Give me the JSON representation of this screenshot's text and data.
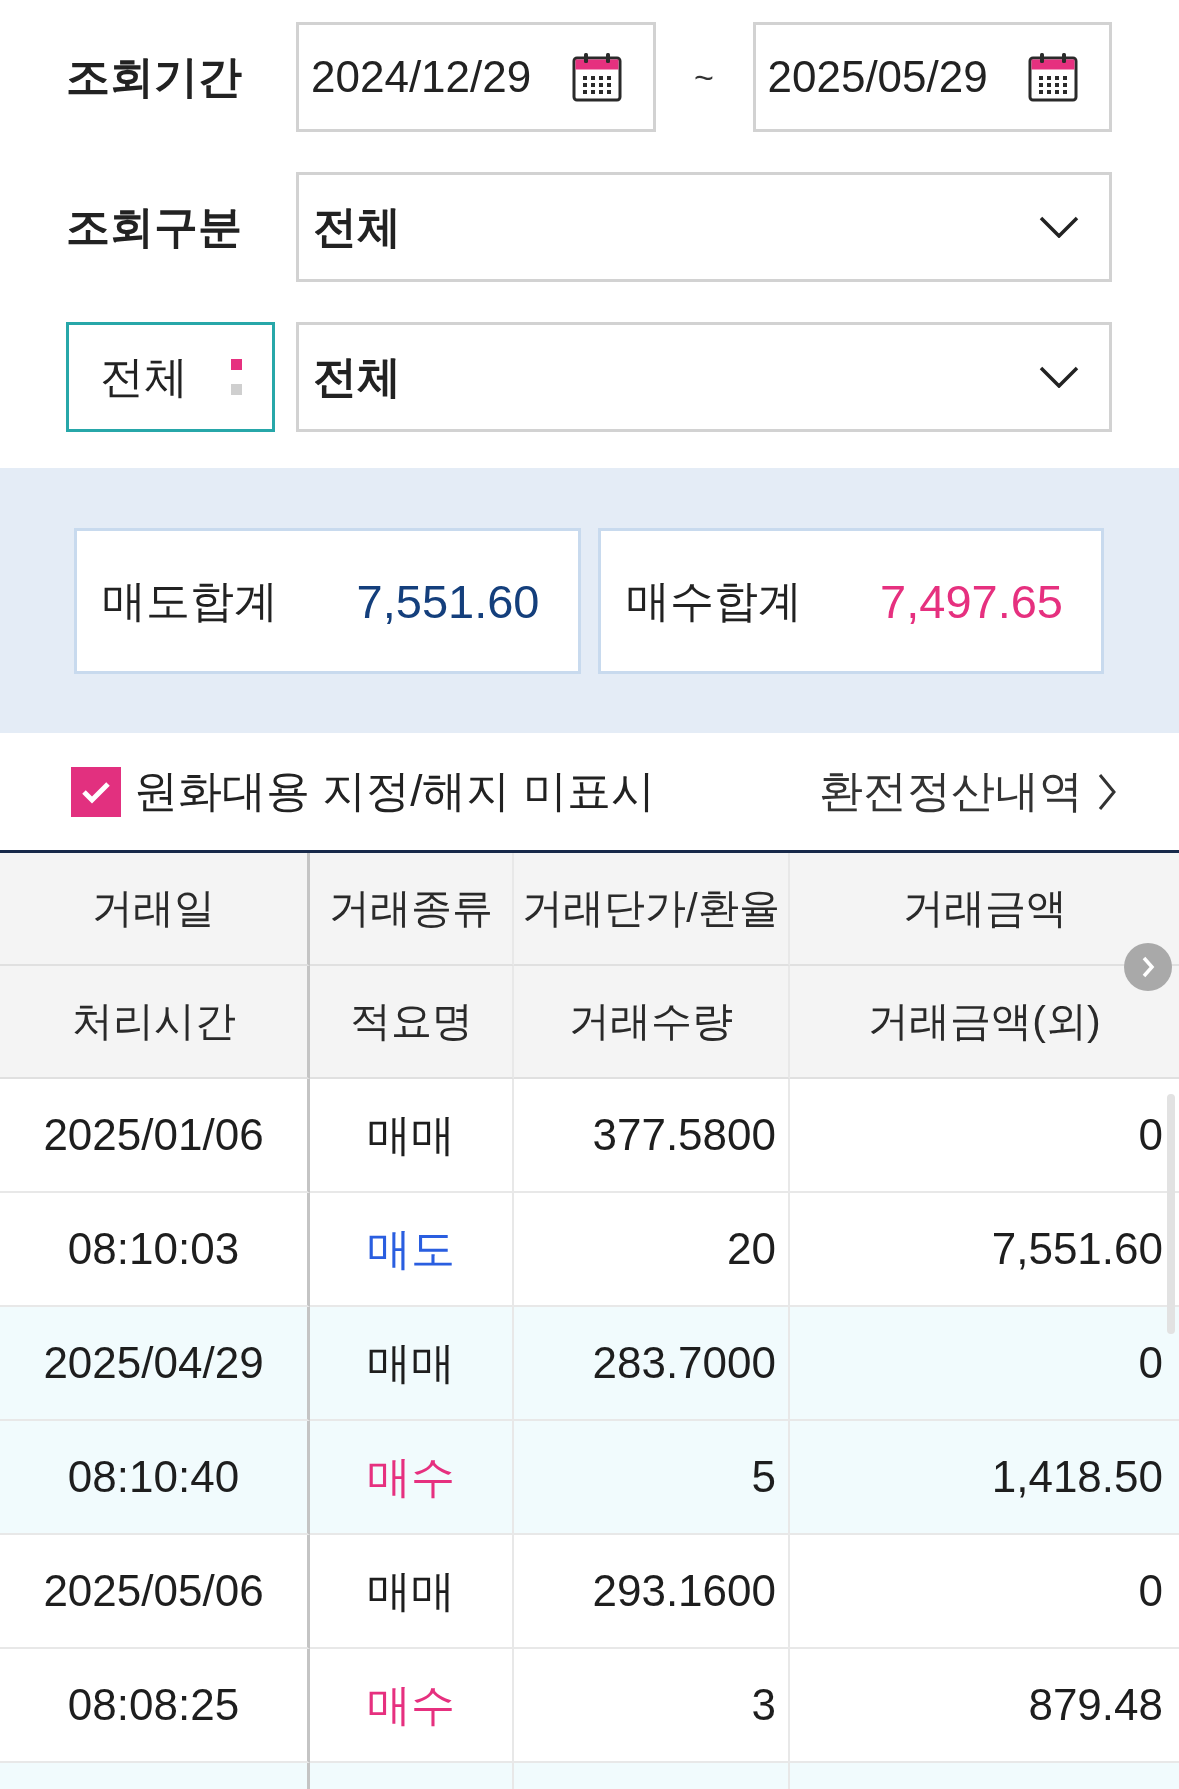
{
  "filters": {
    "period": {
      "label": "조회기간",
      "start": "2024/12/29",
      "separator": "~",
      "end": "2025/05/29"
    },
    "category": {
      "label": "조회구분",
      "value": "전체"
    },
    "scope": {
      "selector": "전체",
      "value": "전체"
    }
  },
  "summary": [
    {
      "label": "매도합계",
      "value": "7,551.60",
      "kind": "sell"
    },
    {
      "label": "매수합계",
      "value": "7,497.65",
      "kind": "buy"
    }
  ],
  "options": {
    "checkbox": {
      "label": "원화대용 지정/해지 미표시",
      "checked": true
    },
    "link": "환전정산내역"
  },
  "table": {
    "columns": [
      {
        "top": "거래일",
        "bottom": "처리시간"
      },
      {
        "top": "거래종류",
        "bottom": "적요명"
      },
      {
        "top": "거래단가/환율",
        "bottom": "거래수량"
      },
      {
        "top": "거래금액",
        "bottom": "거래금액(외)"
      }
    ],
    "rows": [
      {
        "date": "2025/01/06",
        "type": "매매",
        "rate": "377.5800",
        "amount": "0",
        "time": "08:10:03",
        "summary": "매도",
        "kind": "sell",
        "quantity": "20",
        "amount_foreign": "7,551.60"
      },
      {
        "date": "2025/04/29",
        "type": "매매",
        "rate": "283.7000",
        "amount": "0",
        "time": "08:10:40",
        "summary": "매수",
        "kind": "buy",
        "quantity": "5",
        "amount_foreign": "1,418.50"
      },
      {
        "date": "2025/05/06",
        "type": "매매",
        "rate": "293.1600",
        "amount": "0",
        "time": "08:08:25",
        "summary": "매수",
        "kind": "buy",
        "quantity": "3",
        "amount_foreign": "879.48"
      }
    ]
  }
}
